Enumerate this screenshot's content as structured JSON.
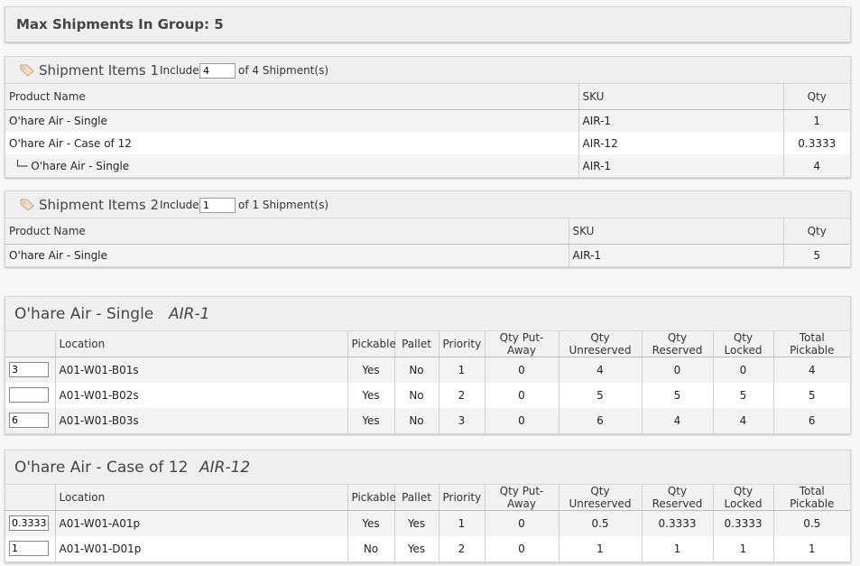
{
  "header": {
    "title": "Max Shipments In Group: 5"
  },
  "shipments": [
    {
      "title": "Shipment Items 1",
      "include_label": "Include",
      "include_value": "4",
      "of_label": "of 4 Shipment(s)",
      "columns": [
        "Product Name",
        "SKU",
        "Qty"
      ],
      "rows": [
        {
          "name": "O'hare Air - Single",
          "sku": "AIR-1",
          "qty": "1"
        },
        {
          "name": "O'hare Air - Case of 12",
          "sku": "AIR-12",
          "qty": "0.3333"
        },
        {
          "name": "└─ O'hare Air - Single",
          "sku": "AIR-1",
          "qty": "4"
        }
      ]
    },
    {
      "title": "Shipment Items 2",
      "include_label": "Include",
      "include_value": "1",
      "of_label": "of 1 Shipment(s)",
      "columns": [
        "Product Name",
        "SKU",
        "Qty"
      ],
      "rows": [
        {
          "name": "O'hare Air - Single",
          "sku": "AIR-1",
          "qty": "5"
        }
      ]
    }
  ],
  "inventory": [
    {
      "product": "O'hare Air - Single",
      "sku": "AIR-1",
      "columns": [
        "",
        "Location",
        "Pickable",
        "Pallet",
        "Priority",
        "Qty Put-Away",
        "Qty Unreserved",
        "Qty Reserved",
        "Qty Locked",
        "Total Pickable"
      ],
      "rows": [
        {
          "input": "3",
          "location": "A01-W01-B01s",
          "pickable": "Yes",
          "pallet": "No",
          "priority": "1",
          "put_away": "0",
          "unreserved": "4",
          "reserved": "0",
          "locked": "0",
          "total": "4"
        },
        {
          "input": "",
          "location": "A01-W01-B02s",
          "pickable": "Yes",
          "pallet": "No",
          "priority": "2",
          "put_away": "0",
          "unreserved": "5",
          "reserved": "5",
          "locked": "5",
          "total": "5"
        },
        {
          "input": "6",
          "location": "A01-W01-B03s",
          "pickable": "Yes",
          "pallet": "No",
          "priority": "3",
          "put_away": "0",
          "unreserved": "6",
          "reserved": "4",
          "locked": "4",
          "total": "6"
        }
      ]
    },
    {
      "product": "O'hare Air - Case of 12",
      "sku": "AIR-12",
      "columns": [
        "",
        "Location",
        "Pickable",
        "Pallet",
        "Priority",
        "Qty Put-Away",
        "Qty Unreserved",
        "Qty Reserved",
        "Qty Locked",
        "Total Pickable"
      ],
      "rows": [
        {
          "input": "0.3333",
          "location": "A01-W01-A01p",
          "pickable": "Yes",
          "pallet": "Yes",
          "priority": "1",
          "put_away": "0",
          "unreserved": "0.5",
          "reserved": "0.3333",
          "locked": "0.3333",
          "total": "0.5"
        },
        {
          "input": "1",
          "location": "A01-W01-D01p",
          "pickable": "No",
          "pallet": "Yes",
          "priority": "2",
          "put_away": "0",
          "unreserved": "1",
          "reserved": "1",
          "locked": "1",
          "total": "1"
        }
      ]
    }
  ]
}
